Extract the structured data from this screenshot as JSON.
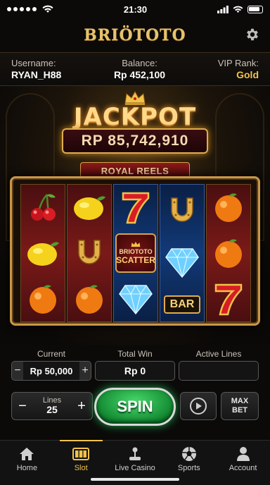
{
  "status_bar": {
    "time": "21:30"
  },
  "header": {
    "brand": "BRIÖTOTO"
  },
  "account": {
    "username_label": "Username:",
    "username": "RYAN_H88",
    "balance_label": "Balance:",
    "balance": "Rp 452,100",
    "vip_label": "VIP Rank:",
    "vip": "Gold"
  },
  "game": {
    "jackpot_title": "JACKPOT",
    "jackpot_amount": "RP 85,742,910",
    "machine_name": "ROYAL REELS",
    "reels": [
      [
        "cherry",
        "lemon",
        "orange"
      ],
      [
        "lemon",
        "horseshoe",
        "orange"
      ],
      [
        "seven",
        "scatter",
        "diamond"
      ],
      [
        "horseshoe",
        "diamond",
        "bar"
      ],
      [
        "orange",
        "orange",
        "seven"
      ]
    ],
    "scatter_brand": "BRIOTOTO",
    "scatter_label": "SCATTER",
    "bar_label": "BAR"
  },
  "bet": {
    "current_label": "Current",
    "current_value": "Rp 50,000",
    "total_win_label": "Total Win",
    "total_win_value": "Rp 0",
    "active_lines_label": "Active Lines",
    "active_lines_value": ""
  },
  "controls": {
    "lines_label": "Lines",
    "lines_value": "25",
    "spin_label": "SPIN",
    "max_label": "MAX",
    "bet_label": "BET"
  },
  "nav": [
    {
      "label": "Home",
      "icon": "home-icon",
      "active": false
    },
    {
      "label": "Slot",
      "icon": "slot-icon",
      "active": true
    },
    {
      "label": "Live Casino",
      "icon": "joystick-icon",
      "active": false
    },
    {
      "label": "Sports",
      "icon": "soccer-ball-icon",
      "active": false
    },
    {
      "label": "Account",
      "icon": "user-icon",
      "active": false
    }
  ],
  "colors": {
    "gold": "#f2c24a",
    "spin_green": "#1fa04a",
    "reel_red": "#7a1a18",
    "reel_blue": "#123a78"
  }
}
